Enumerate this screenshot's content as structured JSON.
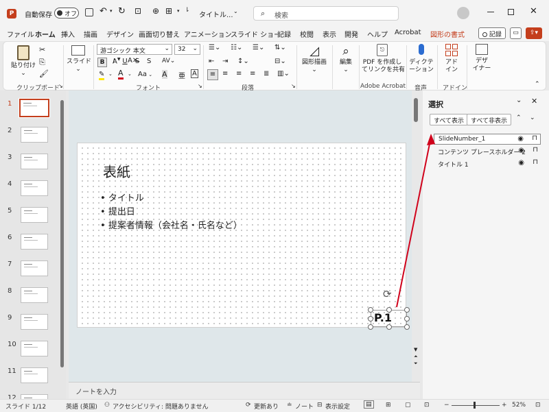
{
  "titlebar": {
    "autosave_label": "自動保存",
    "autosave_state": "オフ",
    "doc_title": "タイトル...",
    "search_placeholder": "検索"
  },
  "tabs": [
    "ファイル",
    "ホーム",
    "挿入",
    "描画",
    "デザイン",
    "画面切り替え",
    "アニメーション",
    "スライド ショー",
    "記録",
    "校閲",
    "表示",
    "開発",
    "ヘルプ",
    "Acrobat",
    "図形の書式"
  ],
  "tab_record_button": "記録",
  "ribbon": {
    "paste": "貼り付け",
    "clipboard": "クリップボード",
    "slide_btn": "スライド",
    "font_name": "游ゴシック 本文",
    "font_size": "32",
    "font_group": "フォント",
    "paragraph_group": "段落",
    "shapes_btn": "図形描画",
    "editing_btn": "編集",
    "pdf_btn_line1": "PDF を作成し",
    "pdf_btn_line2": "てリンクを共有",
    "adobe_group": "Adobe Acrobat",
    "dictation_line1": "ディクテ",
    "dictation_line2": "ーション",
    "voice_group": "音声",
    "addin_line1": "アド",
    "addin_line2": "イン",
    "addin_group": "アドイン",
    "designer_line1": "デザ",
    "designer_line2": "イナー",
    "bold": "B",
    "italic": "I",
    "underline": "U",
    "strike": "S",
    "aa_label": "Aa"
  },
  "slides": {
    "numbers": [
      "1",
      "2",
      "3",
      "4",
      "5",
      "6",
      "7",
      "8",
      "9",
      "10",
      "11",
      "12"
    ],
    "current": "1"
  },
  "slide": {
    "title": "表紙",
    "bullets": [
      "タイトル",
      "提出日",
      "提案者情報（会社名・氏名など）"
    ],
    "slide_number": "P.1"
  },
  "notes_placeholder": "ノートを入力",
  "selection_pane": {
    "title": "選択",
    "show_all": "すべて表示",
    "hide_all": "すべて非表示",
    "items": [
      "SlideNumber_1",
      "コンテンツ プレースホルダー 2",
      "タイトル 1"
    ]
  },
  "status": {
    "slide_info": "スライド 1/12",
    "language": "英語 (英国)",
    "accessibility": "アクセシビリティ: 問題ありません",
    "updates": "更新あり",
    "notes": "ノート",
    "display_settings": "表示設定",
    "zoom": "52%"
  },
  "colors": {
    "accent": "#c43e1c",
    "arrow": "#d0021b"
  }
}
